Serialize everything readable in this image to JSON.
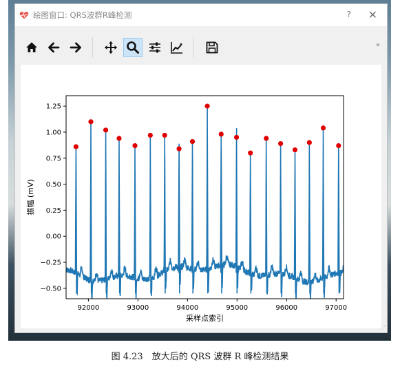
{
  "window": {
    "title": "绘图窗口: QRS波群R峰检测",
    "help_label": "?",
    "close_label": "✕",
    "overflow_label": "»"
  },
  "toolbar": {
    "icons": [
      "home-icon",
      "back-arrow-icon",
      "forward-arrow-icon",
      "pan-icon",
      "zoom-icon",
      "configure-subplots-icon",
      "edit-axis-icon",
      "save-icon"
    ],
    "active": "zoom-icon"
  },
  "colors": {
    "signal": "#1f77b4",
    "peaks": "#e00000",
    "toolbar_active_bg": "#cce4f7"
  },
  "caption": "图 4.23　放大后的 QRS 波群 R 峰检测结果",
  "chart_data": {
    "type": "line",
    "xlabel": "采样点索引",
    "ylabel": "振幅 (mV)",
    "xlim": [
      91550,
      97150
    ],
    "ylim": [
      -0.6,
      1.35
    ],
    "xticks": [
      92000,
      93000,
      94000,
      95000,
      96000,
      97000
    ],
    "yticks": [
      1.25,
      1.0,
      0.75,
      0.5,
      0.25,
      0.0,
      -0.25,
      -0.5
    ],
    "ytick_labels": [
      "1.25",
      "1.00",
      "0.75",
      "0.50",
      "0.25",
      "0.00",
      "−0.25",
      "−0.50"
    ],
    "grid": false,
    "series": [
      {
        "kind": "ecg_signal",
        "color": "#1f77b4",
        "baseline": -0.35,
        "r_peaks": {
          "x": [
            91750,
            92050,
            92350,
            92620,
            92940,
            93250,
            93540,
            93830,
            94100,
            94400,
            94680,
            94990,
            95270,
            95590,
            95880,
            96170,
            96460,
            96740,
            97050
          ],
          "y": [
            0.86,
            1.1,
            1.02,
            0.94,
            0.87,
            0.97,
            0.97,
            0.84,
            0.91,
            1.25,
            0.98,
            0.95,
            0.8,
            0.94,
            0.89,
            0.83,
            0.9,
            1.04,
            0.87
          ]
        }
      },
      {
        "kind": "detected_peaks",
        "marker": "circle",
        "color": "#e00000"
      }
    ]
  }
}
